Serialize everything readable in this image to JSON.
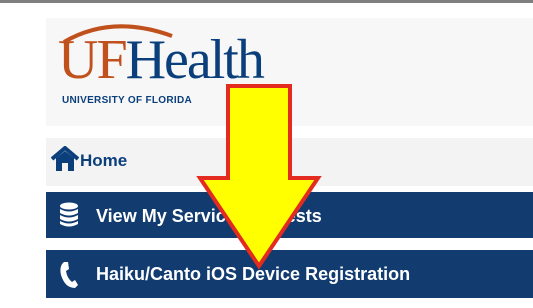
{
  "logo": {
    "uf": "UF",
    "health": "Health",
    "sub": "UNIVERSITY OF FLORIDA"
  },
  "nav": {
    "home_label": "Home",
    "items": [
      {
        "label": "View My Service Requests",
        "icon": "database-icon"
      },
      {
        "label": "Haiku/Canto iOS Device Registration",
        "icon": "phone-icon"
      }
    ]
  },
  "overlay": {
    "arrow_color": "#ffff00",
    "arrow_outline": "#e32b1f"
  },
  "colors": {
    "nav_bg": "#123c70",
    "brand_blue": "#0b3f7c",
    "brand_orange": "#c0501c"
  }
}
